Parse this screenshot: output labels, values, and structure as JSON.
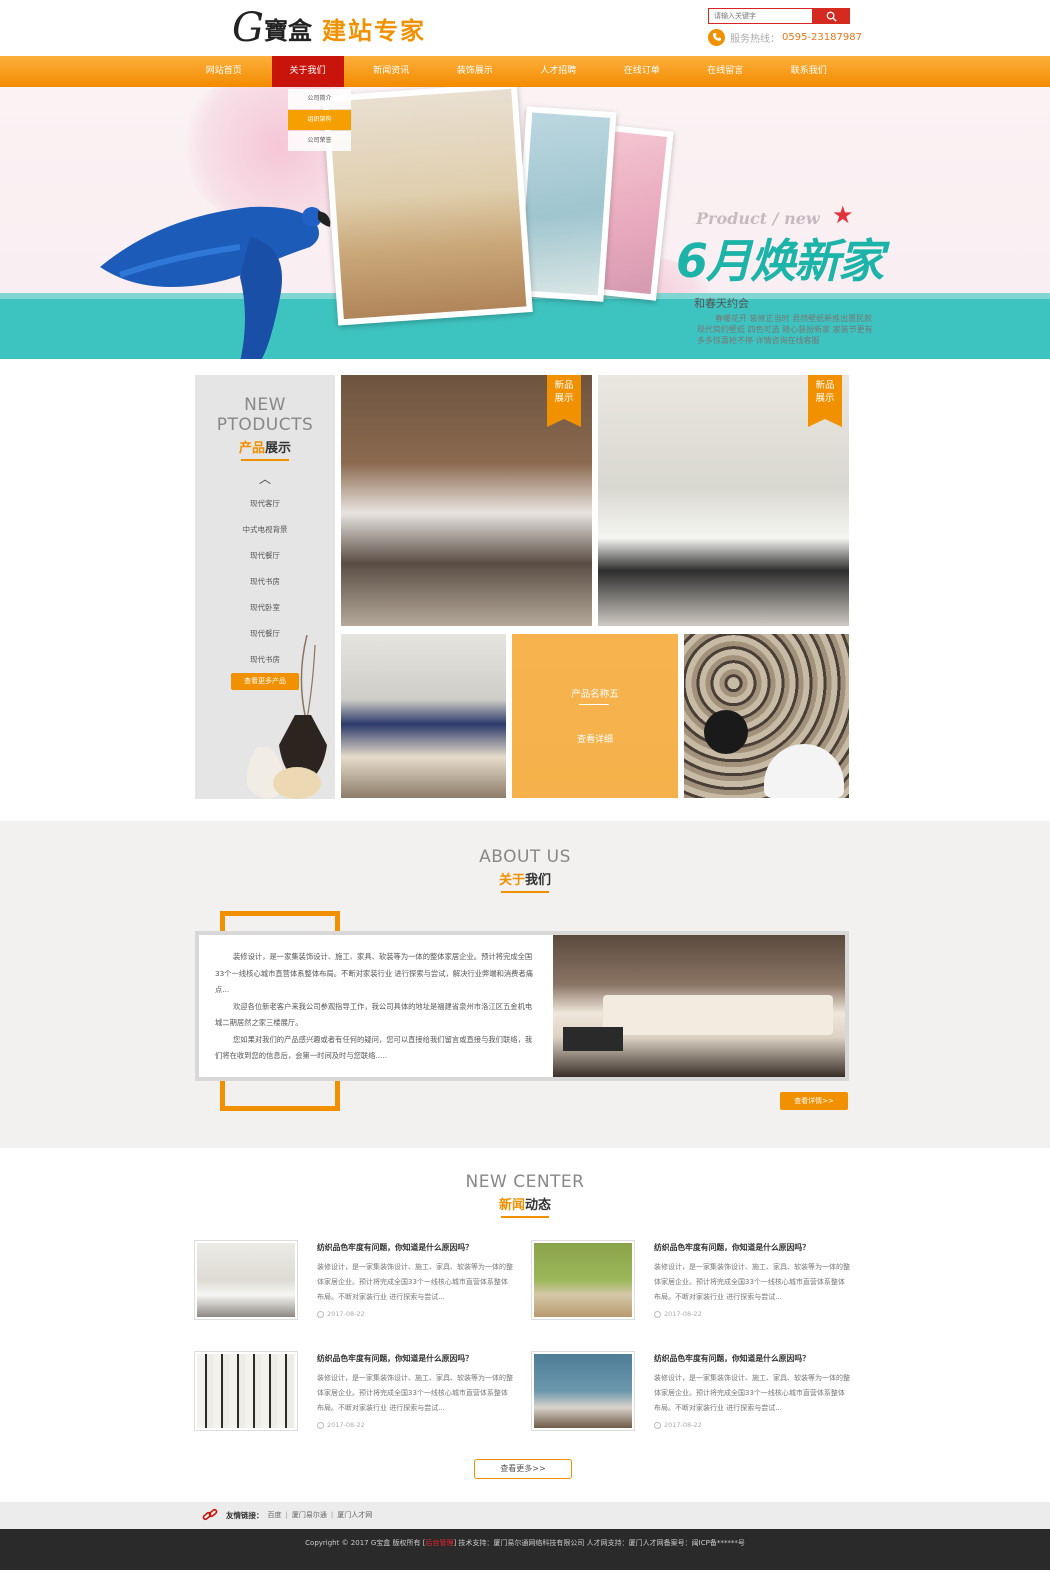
{
  "header": {
    "logo_mark": "G",
    "logo_brand": "寶盒",
    "logo_slogan": "建站专家",
    "search_placeholder": "请输入关键字",
    "hotline_label": "服务热线：",
    "hotline_number": "0595-23187987"
  },
  "nav": {
    "items": [
      {
        "label": "网站首页"
      },
      {
        "label": "关于我们"
      },
      {
        "label": "新闻资讯"
      },
      {
        "label": "装饰展示"
      },
      {
        "label": "人才招聘"
      },
      {
        "label": "在线订单"
      },
      {
        "label": "在线留言"
      },
      {
        "label": "联系我们"
      }
    ],
    "dropdown": [
      {
        "label": "公司简介"
      },
      {
        "label": "组织架构"
      },
      {
        "label": "公司荣誉"
      }
    ]
  },
  "banner": {
    "eng": "Product / new",
    "title": "6月焕新家",
    "subtitle": "和春天约会",
    "text": "春暖花开 装修正当时 君然壁纸新推出惠民款现代简约壁纸 四色可选 随心装扮新家 家装节更有多多惊喜抢不停 详情咨询在线客服"
  },
  "products": {
    "title_en": "NEW PTODUCTS",
    "title_cn_hl": "产品",
    "title_cn": "展示",
    "categories": [
      "现代客厅",
      "中式电视背景",
      "现代餐厅",
      "现代书房",
      "现代卧室",
      "现代餐厅",
      "现代书房"
    ],
    "more_label": "查看更多产品",
    "tag_label": "新品\n展示",
    "tile_name": "产品名称五",
    "tile_more": "查看详细"
  },
  "about": {
    "title_en": "ABOUT US",
    "title_cn_hl": "关于",
    "title_cn": "我们",
    "p1": "装修设计，是一家集装饰设计、施工、家具、软装等为一体的整体家居企业。预计将完成全国33个一线核心城市直营体系整体布局。不断对家装行业 进行探索与尝试，解决行业弊端和消费者痛点...",
    "p2": "欢迎各位新老客户来我公司参观指导工作，我公司具体的地址是福建省泉州市洛江区五金机电城二期居然之家三楼展厅。",
    "p3": "您如果对我们的产品感兴趣或者有任何的疑问，您可以直接给我们留言或直接与我们联络，我们将在收到您的信息后，会第一时间及时与您联络.....",
    "more_label": "查看详情>>"
  },
  "news": {
    "title_en": "NEW CENTER",
    "title_cn_hl": "新闻",
    "title_cn": "动态",
    "items": [
      {
        "title": "纺织品色牢度有问题，你知道是什么原因吗？",
        "summary": "装修设计，是一家集装饰设计、施工、家具、软装等为一体的整体家居企业。预计将完成全国33个一线核心城市直营体系整体布局。不断对家装行业 进行探索与尝试...",
        "date": "2017-08-22"
      },
      {
        "title": "纺织品色牢度有问题，你知道是什么原因吗？",
        "summary": "装修设计，是一家集装饰设计、施工、家具、软装等为一体的整体家居企业。预计将完成全国33个一线核心城市直营体系整体布局。不断对家装行业 进行探索与尝试...",
        "date": "2017-08-22"
      },
      {
        "title": "纺织品色牢度有问题，你知道是什么原因吗？",
        "summary": "装修设计，是一家集装饰设计、施工、家具、软装等为一体的整体家居企业。预计将完成全国33个一线核心城市直营体系整体布局。不断对家装行业 进行探索与尝试...",
        "date": "2017-08-22"
      },
      {
        "title": "纺织品色牢度有问题，你知道是什么原因吗？",
        "summary": "装修设计，是一家集装饰设计、施工、家具、软装等为一体的整体家居企业。预计将完成全国33个一线核心城市直营体系整体布局。不断对家装行业 进行探索与尝试...",
        "date": "2017-08-22"
      }
    ],
    "more_label": "查看更多>>"
  },
  "links": {
    "label": "友情链接：",
    "items": [
      "百度",
      "厦门易尔通",
      "厦门人才网"
    ],
    "sep": "|"
  },
  "footer": {
    "prefix": "Copyright © 2017 G宝盒 版权所有 [",
    "admin": "后台管理",
    "suffix": "]   技术支持：厦门易尔通网络科技有限公司 人才网支持：厦门人才网备案号：闽ICP备******号"
  },
  "colors": {
    "accent": "#f29100",
    "nav_active": "#c8140a",
    "teal": "#3ec4c0"
  }
}
